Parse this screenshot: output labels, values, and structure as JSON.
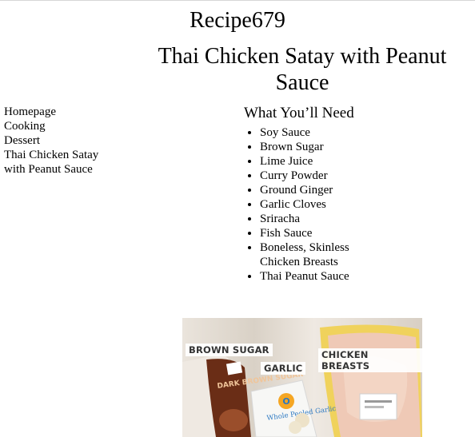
{
  "site": {
    "title": "Recipe679"
  },
  "recipe": {
    "title": "Thai Chicken Satay with Peanut Sauce"
  },
  "breadcrumb": [
    "Homepage",
    "Cooking",
    "Dessert",
    "Thai Chicken Satay with Peanut Sauce"
  ],
  "ingredients": {
    "heading": "What You’ll Need",
    "items": [
      "Soy Sauce",
      "Brown Sugar",
      "Lime Juice",
      "Curry Powder",
      "Ground Ginger",
      "Garlic Cloves",
      "Sriracha",
      "Fish Sauce",
      "Boneless, Skinless Chicken Breasts",
      "Thai Peanut Sauce"
    ]
  },
  "photo": {
    "labels": {
      "brown_sugar": "BROWN SUGAR",
      "garlic": "GARLIC",
      "chicken": "CHICKEN BREASTS"
    },
    "package_text": {
      "brown_sugar_pack": "DARK BROWN SUGAR",
      "garlic_pack": "Whole Peeled Garlic"
    }
  }
}
